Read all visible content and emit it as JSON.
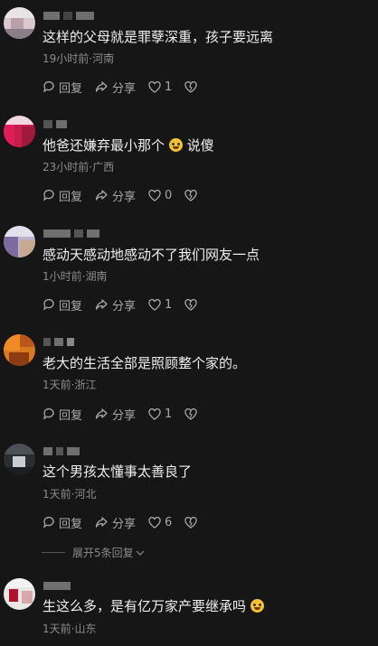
{
  "comments": [
    {
      "text": "这样的父母就是罪孽深重，孩子要远离",
      "meta": "19小时前·河南",
      "reply_label": "回复",
      "share_label": "分享",
      "likes": "1"
    },
    {
      "text": "他爸还嫌弃最小那个",
      "text_suffix": "说傻",
      "meta": "23小时前·广西",
      "reply_label": "回复",
      "share_label": "分享",
      "likes": "0"
    },
    {
      "text": "感动天感动地感动不了我们网友一点",
      "meta": "1小时前·湖南",
      "reply_label": "回复",
      "share_label": "分享",
      "likes": "1"
    },
    {
      "text": "老大的生活全部是照顾整个家的。",
      "meta": "1天前·浙江",
      "reply_label": "回复",
      "share_label": "分享",
      "likes": "1"
    },
    {
      "text": "这个男孩太懂事太善良了",
      "meta": "1天前·河北",
      "reply_label": "回复",
      "share_label": "分享",
      "likes": "6"
    },
    {
      "text": "生这么多，是有亿万家产要继承吗",
      "meta": "1天前·山东"
    }
  ],
  "expand_replies": "展开5条回复",
  "icons": {
    "reply": "reply-icon",
    "share": "share-icon",
    "like": "heart-icon",
    "dislike": "broken-heart-icon",
    "emoji": "grinning-emoji-icon"
  },
  "colors": {
    "background": "#161616",
    "text": "#efefef",
    "meta": "#8c8c8c"
  }
}
